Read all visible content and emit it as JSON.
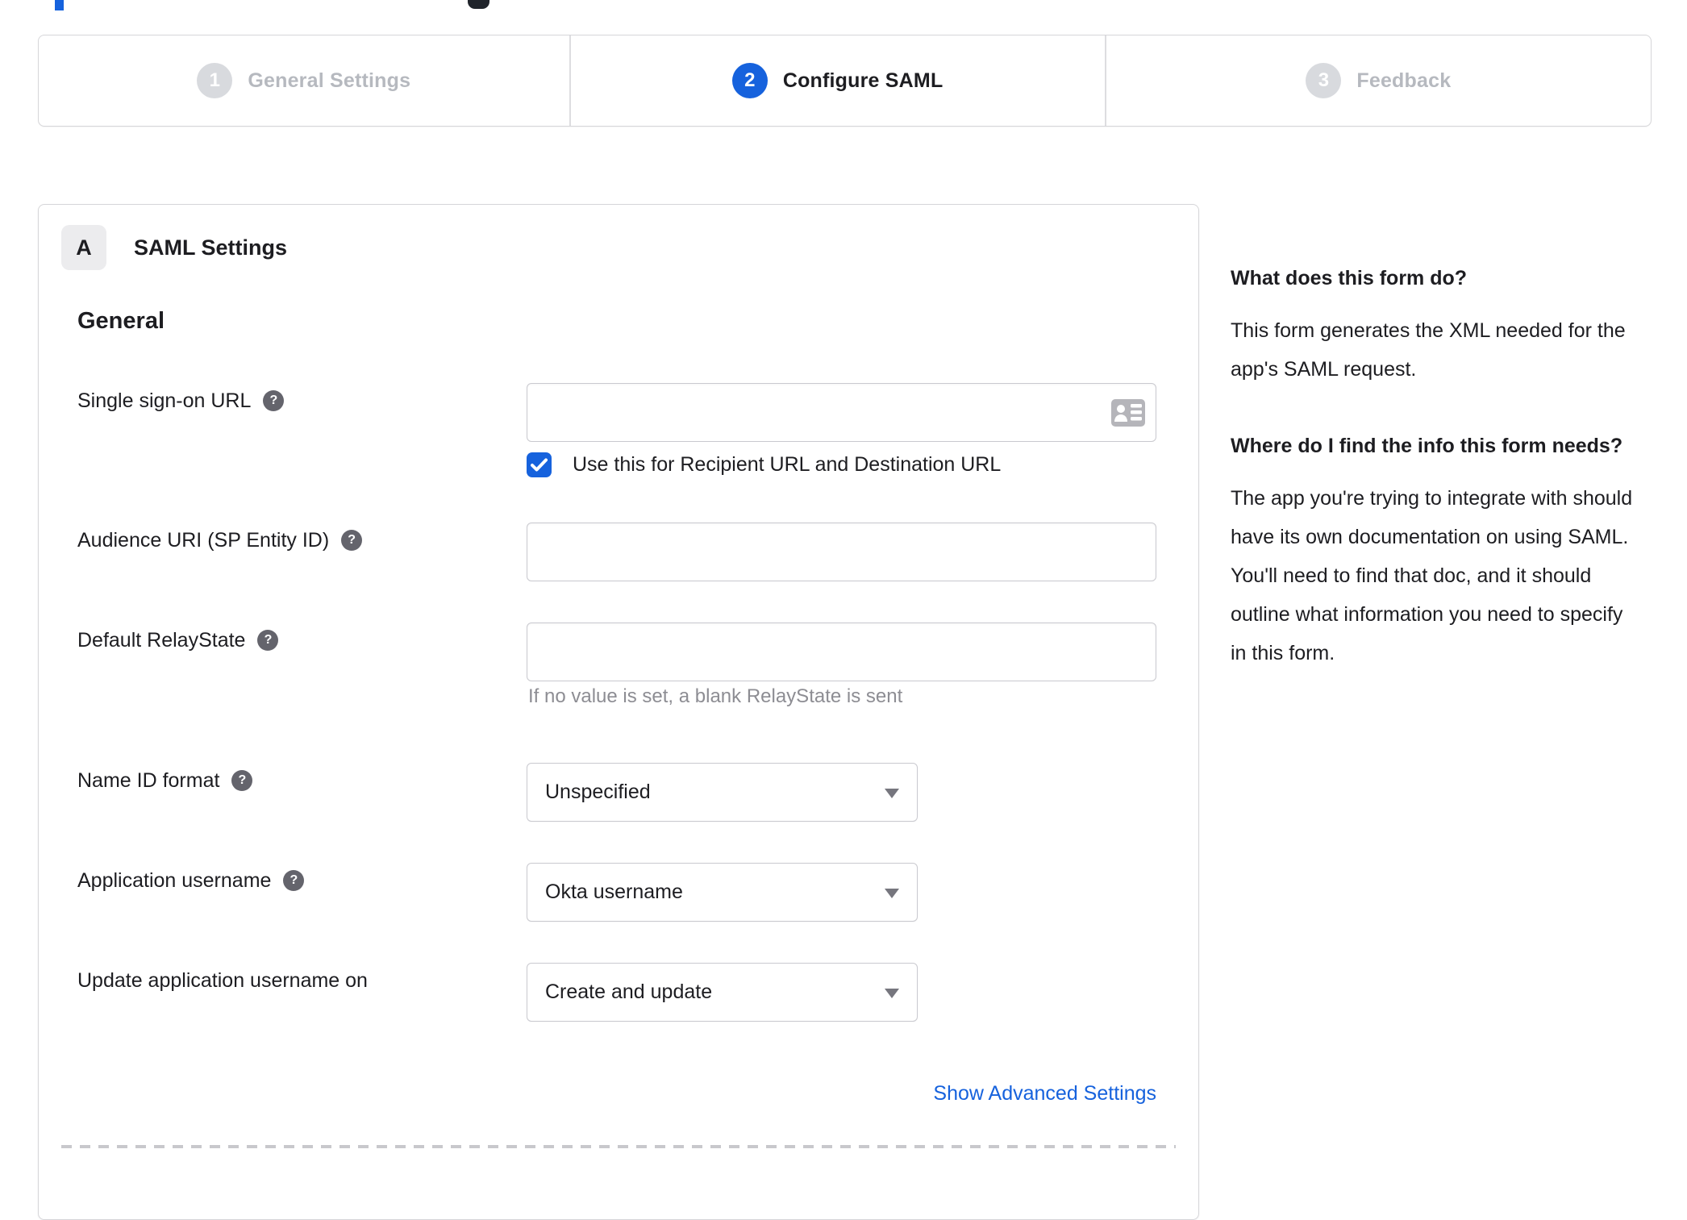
{
  "stepper": {
    "steps": [
      {
        "number": "1",
        "label": "General Settings",
        "state": "inactive"
      },
      {
        "number": "2",
        "label": "Configure SAML",
        "state": "active"
      },
      {
        "number": "3",
        "label": "Feedback",
        "state": "inactive"
      }
    ]
  },
  "panel": {
    "badge": "A",
    "title": "SAML Settings",
    "section_heading": "General",
    "help_glyph": "?",
    "fields": {
      "sso": {
        "label": "Single sign-on URL",
        "value": "",
        "checkbox_label": "Use this for Recipient URL and Destination URL",
        "checkbox_checked": true
      },
      "audience": {
        "label": "Audience URI (SP Entity ID)",
        "value": ""
      },
      "relay": {
        "label": "Default RelayState",
        "value": "",
        "hint": "If no value is set, a blank RelayState is sent"
      },
      "name_id": {
        "label": "Name ID format",
        "value": "Unspecified"
      },
      "app_username": {
        "label": "Application username",
        "value": "Okta username"
      },
      "update_username": {
        "label": "Update application username on",
        "value": "Create and update"
      }
    },
    "advanced_link": "Show Advanced Settings"
  },
  "sidebar": {
    "q1_heading": "What does this form do?",
    "q1_body": "This form generates the XML needed for the app's SAML request.",
    "q2_heading": "Where do I find the info this form needs?",
    "q2_body": "The app you're trying to integrate with should have its own documentation on using SAML. You'll need to find that doc, and it should outline what information you need to specify in this form."
  },
  "colors": {
    "accent_blue": "#1662dd",
    "inactive_step_gray": "#d8dade",
    "text_dark": "#1d1d21",
    "muted_text": "#8d8d93",
    "border_gray": "#c9c9cf"
  }
}
